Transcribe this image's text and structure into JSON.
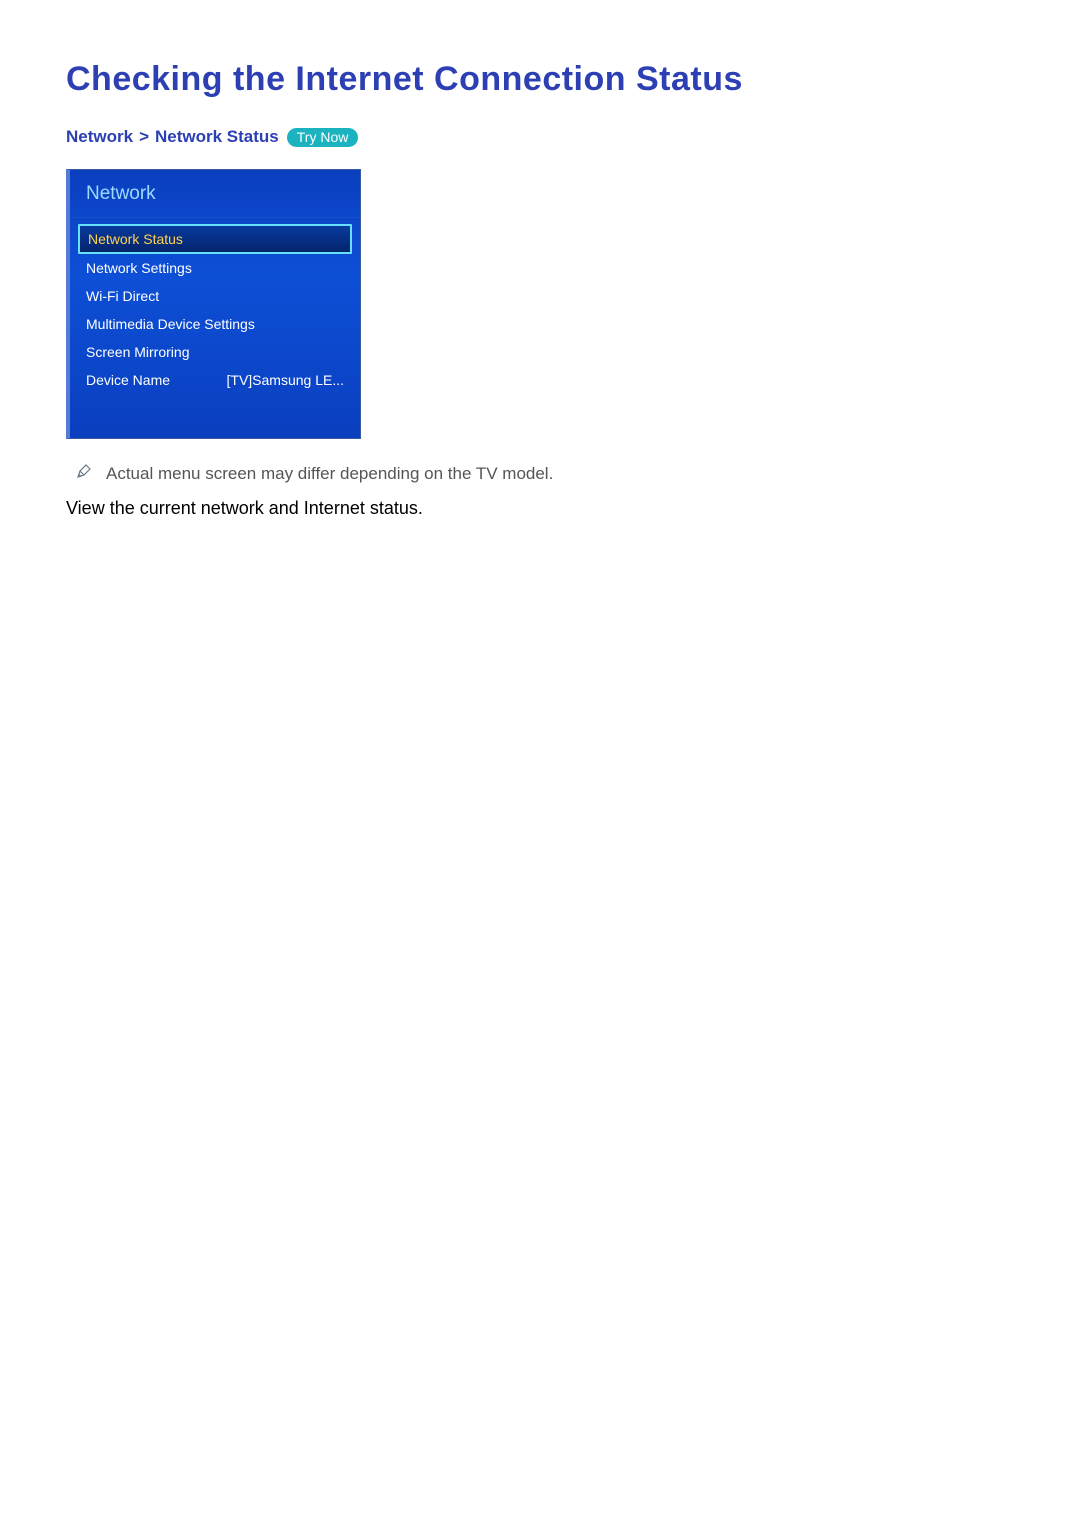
{
  "title": "Checking the Internet Connection Status",
  "breadcrumb": {
    "part1": "Network",
    "sep": ">",
    "part2": "Network Status",
    "try_now": "Try Now"
  },
  "menu": {
    "header": "Network",
    "items": [
      {
        "label": "Network Status",
        "value": "",
        "selected": true
      },
      {
        "label": "Network Settings",
        "value": "",
        "selected": false
      },
      {
        "label": "Wi-Fi Direct",
        "value": "",
        "selected": false
      },
      {
        "label": "Multimedia Device Settings",
        "value": "",
        "selected": false
      },
      {
        "label": "Screen Mirroring",
        "value": "",
        "selected": false
      },
      {
        "label": "Device Name",
        "value": "[TV]Samsung LE...",
        "selected": false
      }
    ]
  },
  "note": "Actual menu screen may differ depending on the TV model.",
  "description": "View the current network and Internet status."
}
